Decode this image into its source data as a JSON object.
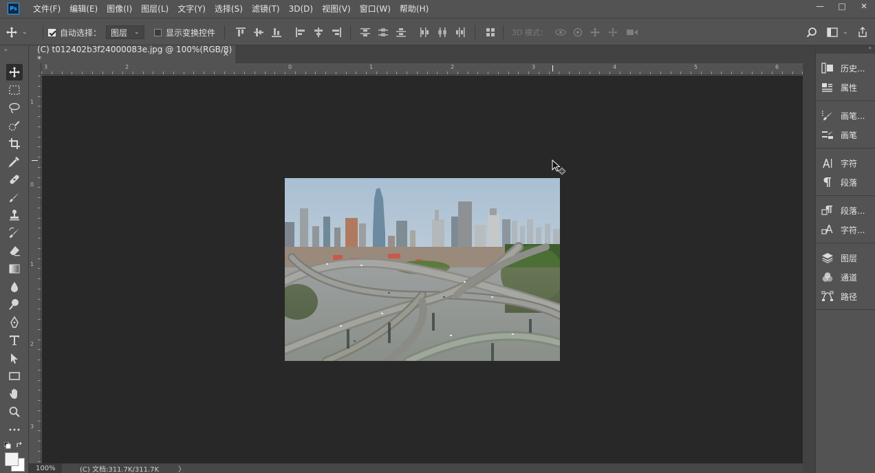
{
  "app": {
    "logo_text": "Ps"
  },
  "menu": [
    "文件(F)",
    "编辑(E)",
    "图像(I)",
    "图层(L)",
    "文字(Y)",
    "选择(S)",
    "滤镜(T)",
    "3D(D)",
    "视图(V)",
    "窗口(W)",
    "帮助(H)"
  ],
  "window_controls": {
    "minimize": "—",
    "maximize": "□",
    "close": "✕"
  },
  "options": {
    "auto_select_label": "自动选择：",
    "auto_select_checked": true,
    "auto_select_target": "图层",
    "show_transform_label": "显示变换控件",
    "show_transform_checked": false,
    "mode_3d_label": "3D 模式："
  },
  "document": {
    "tab_title": "(C) t012402b3f24000083e.jpg @ 100%(RGB/8) *",
    "close_glyph": "✕"
  },
  "ruler_h_labels": [
    "3",
    "2",
    "0",
    "1",
    "2",
    "3",
    "4",
    "5",
    "6"
  ],
  "ruler_v_labels": [
    "1",
    "0",
    "1",
    "2",
    "3"
  ],
  "status": {
    "zoom": "100%",
    "doc_info": "(C) 文档:311.7K/311.7K",
    "arrow": "〉"
  },
  "panels": [
    {
      "label": "历史...",
      "icon": "history-icon"
    },
    {
      "label": "属性",
      "icon": "properties-icon"
    },
    {
      "label": "画笔...",
      "icon": "brush-settings-icon"
    },
    {
      "label": "画笔",
      "icon": "brushes-icon"
    },
    {
      "label": "字符",
      "icon": "character-icon"
    },
    {
      "label": "段落",
      "icon": "paragraph-icon"
    },
    {
      "label": "段落...",
      "icon": "paragraph-styles-icon"
    },
    {
      "label": "字符...",
      "icon": "character-styles-icon"
    },
    {
      "label": "图层",
      "icon": "layers-icon"
    },
    {
      "label": "通道",
      "icon": "channels-icon"
    },
    {
      "label": "路径",
      "icon": "paths-icon"
    }
  ],
  "colors": {
    "ui_bg": "#535353",
    "canvas_bg": "#282828",
    "accent": "#31a8ff"
  }
}
